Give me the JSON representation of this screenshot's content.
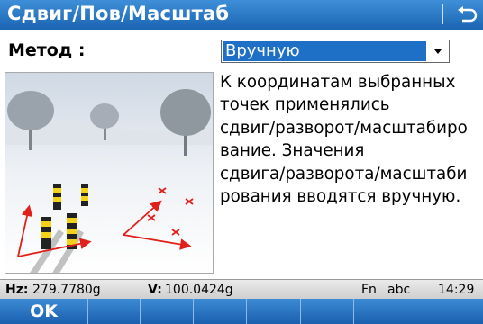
{
  "titlebar": {
    "title": "Сдвиг/Пов/Масштаб",
    "back_icon": "back-arrow-icon"
  },
  "form": {
    "method_label": "Метод :",
    "method_value": "Вручную"
  },
  "description": "К координатам выбранных\nточек применялись\nсдвиг/разворот/масштабиро\nвание. Значения\nсдвига/разворота/масштаби\nрования вводятся вручную.",
  "statusbar": {
    "hz_label": "Hz:",
    "hz_value": "279.7780g",
    "v_label": "V:",
    "v_value": "100.0424g",
    "fn": "Fn",
    "input_mode": "abc",
    "time": "14:29"
  },
  "softkeys": [
    "OK",
    "",
    "",
    "",
    "",
    "",
    ""
  ],
  "colors": {
    "titlebar": "#1a64b2",
    "selection": "#1e6fc6",
    "arrows": "#e0201a"
  }
}
